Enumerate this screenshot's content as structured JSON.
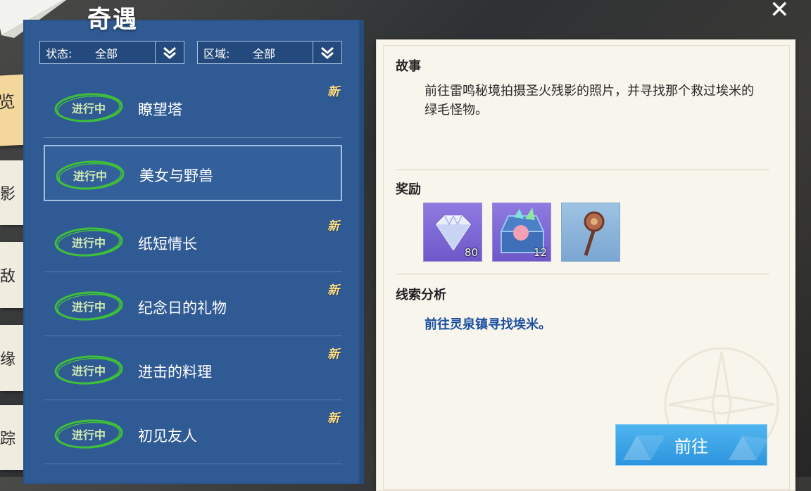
{
  "window": {
    "title": "奇遇",
    "close_icon": "close-icon"
  },
  "side_tabs": [
    "览",
    "影",
    "敌",
    "缘",
    "踪"
  ],
  "filters": [
    {
      "label": "状态:",
      "value": "全部"
    },
    {
      "label": "区域:",
      "value": "全部"
    }
  ],
  "quests": [
    {
      "status": "进行中",
      "name": "瞭望塔",
      "new": "新",
      "selected": false
    },
    {
      "status": "进行中",
      "name": "美女与野兽",
      "new": "",
      "selected": true
    },
    {
      "status": "进行中",
      "name": "纸短情长",
      "new": "新",
      "selected": false
    },
    {
      "status": "进行中",
      "name": "纪念日的礼物",
      "new": "新",
      "selected": false
    },
    {
      "status": "进行中",
      "name": "进击的料理",
      "new": "新",
      "selected": false
    },
    {
      "status": "进行中",
      "name": "初见友人",
      "new": "新",
      "selected": false
    }
  ],
  "detail": {
    "story_title": "故事",
    "story_text": "前往雷鸣秘境拍摄圣火残影的照片，并寻找那个救过埃米的绿毛怪物。",
    "reward_title": "奖励",
    "rewards": [
      {
        "icon": "diamond-icon",
        "count": "80"
      },
      {
        "icon": "treasure-box-icon",
        "count": "12"
      },
      {
        "icon": "staff-icon",
        "count": ""
      }
    ],
    "clue_title": "线索分析",
    "clue_text": "前往灵泉镇寻找埃米。",
    "go_button": "前往"
  },
  "colors": {
    "panel_blue": "#2f5a94",
    "stamp_green": "#3fbf3a",
    "new_yellow": "#ffe08a",
    "clue_blue": "#1c4fa0",
    "button_blue": "#2d95df"
  }
}
